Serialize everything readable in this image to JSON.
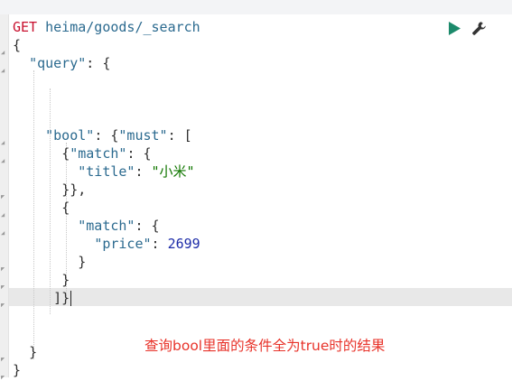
{
  "request": {
    "method": "GET",
    "path": "heima/goods/_search"
  },
  "code": {
    "l2": "{",
    "l3_key": "\"query\"",
    "l3_rest": ": {",
    "l7_key": "\"bool\"",
    "l7_mid": ": {",
    "l7_key2": "\"must\"",
    "l7_rest": ": [",
    "l8_open": "{",
    "l8_key": "\"match\"",
    "l8_rest": ": {",
    "l9_key": "\"title\"",
    "l9_colon": ": ",
    "l9_val": "\"小米\"",
    "l10": "}},",
    "l11": "{",
    "l12_key": "\"match\"",
    "l12_rest": ": {",
    "l13_key": "\"price\"",
    "l13_colon": ": ",
    "l13_val": "2699",
    "l14": "}",
    "l15": "}",
    "l16": "]}",
    "l19": "}",
    "l20": "}"
  },
  "toolbar": {
    "run_icon": "play-icon",
    "settings_icon": "wrench-icon",
    "run_color": "#1c8a6b"
  },
  "annotation": "查询bool里面的条件全为true时的结果"
}
